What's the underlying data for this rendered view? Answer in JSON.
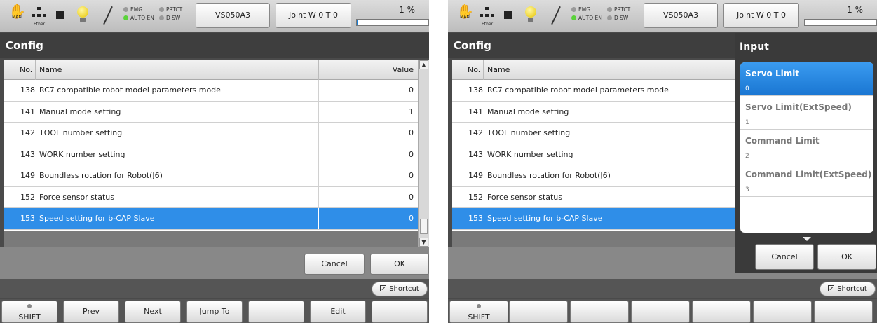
{
  "status": {
    "hand_label": "MAN",
    "ether_label": "Ether",
    "emg": "EMG",
    "prtct": "PRTCT",
    "auto_en": "AUTO EN",
    "dsw": "D SW",
    "robot_model": "VS050A3",
    "joint_mode": "Joint W 0 T 0",
    "speed_percent": "1 %",
    "speed_fraction": 0.01
  },
  "title": "Config",
  "columns": {
    "no": "No.",
    "name": "Name",
    "value": "Value"
  },
  "rows": [
    {
      "no": "138",
      "name": "RC7 compatible robot model parameters mode",
      "value": "0"
    },
    {
      "no": "141",
      "name": "Manual mode setting",
      "value": "1"
    },
    {
      "no": "142",
      "name": "TOOL number setting",
      "value": "0"
    },
    {
      "no": "143",
      "name": "WORK number setting",
      "value": "0"
    },
    {
      "no": "149",
      "name": "Boundless rotation for Robot(J6)",
      "value": "0"
    },
    {
      "no": "152",
      "name": "Force sensor status",
      "value": "0"
    },
    {
      "no": "153",
      "name": "Speed setting for b-CAP Slave",
      "value": "0"
    }
  ],
  "selected_row_index": 6,
  "buttons": {
    "cancel": "Cancel",
    "ok": "OK",
    "shortcut": "Shortcut"
  },
  "fkeys": [
    "SHIFT",
    "Prev",
    "Next",
    "Jump To",
    "",
    "Edit",
    ""
  ],
  "input_popup": {
    "title": "Input",
    "options": [
      {
        "label": "Servo Limit",
        "value": "0"
      },
      {
        "label": "Servo Limit(ExtSpeed)",
        "value": "1"
      },
      {
        "label": "Command Limit",
        "value": "2"
      },
      {
        "label": "Command Limit(ExtSpeed)",
        "value": "3"
      }
    ],
    "selected_index": 0,
    "cancel": "Cancel",
    "ok": "OK"
  },
  "colors": {
    "selection": "#2f8ee8",
    "led_on": "#5ad23a",
    "led_off": "#9a9a9a"
  }
}
